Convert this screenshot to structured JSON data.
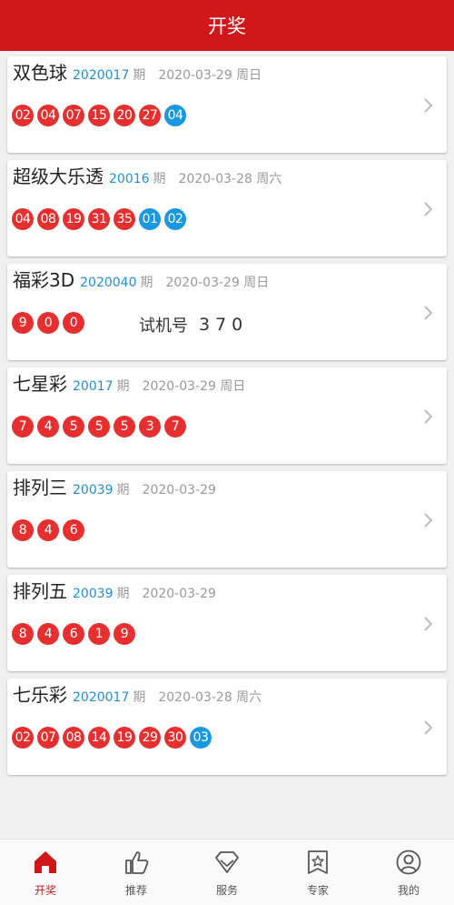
{
  "header": {
    "title": "开奖"
  },
  "lotteries": [
    {
      "name": "双色球",
      "issue": "2020017",
      "qi": "期",
      "date": "2020-03-29 周日",
      "red": [
        "02",
        "04",
        "07",
        "15",
        "20",
        "27"
      ],
      "blue": [
        "04"
      ]
    },
    {
      "name": "超级大乐透",
      "issue": "20016",
      "qi": "期",
      "date": "2020-03-28 周六",
      "red": [
        "04",
        "08",
        "19",
        "31",
        "35"
      ],
      "blue": [
        "01",
        "02"
      ]
    },
    {
      "name": "福彩3D",
      "issue": "2020040",
      "qi": "期",
      "date": "2020-03-29 周日",
      "red": [
        "9",
        "0",
        "0"
      ],
      "blue": [],
      "trial_label": "试机号",
      "trial_number": "370"
    },
    {
      "name": "七星彩",
      "issue": "20017",
      "qi": "期",
      "date": "2020-03-29 周日",
      "red": [
        "7",
        "4",
        "5",
        "5",
        "5",
        "3",
        "7"
      ],
      "blue": []
    },
    {
      "name": "排列三",
      "issue": "20039",
      "qi": "期",
      "date": "2020-03-29",
      "red": [
        "8",
        "4",
        "6"
      ],
      "blue": []
    },
    {
      "name": "排列五",
      "issue": "20039",
      "qi": "期",
      "date": "2020-03-29",
      "red": [
        "8",
        "4",
        "6",
        "1",
        "9"
      ],
      "blue": []
    },
    {
      "name": "七乐彩",
      "issue": "2020017",
      "qi": "期",
      "date": "2020-03-28 周六",
      "red": [
        "02",
        "07",
        "08",
        "14",
        "19",
        "29",
        "30"
      ],
      "blue": [
        "03"
      ]
    }
  ],
  "tabs": [
    {
      "label": "开奖",
      "icon": "home-icon",
      "active": true
    },
    {
      "label": "推荐",
      "icon": "thumbs-up-icon",
      "active": false
    },
    {
      "label": "服务",
      "icon": "diamond-icon",
      "active": false
    },
    {
      "label": "专家",
      "icon": "star-bookmark-icon",
      "active": false
    },
    {
      "label": "我的",
      "icon": "user-icon",
      "active": false
    }
  ],
  "colors": {
    "header": "#d0181b",
    "red_ball": "#e82f2f",
    "blue_ball": "#1997e0",
    "issue": "#1f8fd8"
  }
}
